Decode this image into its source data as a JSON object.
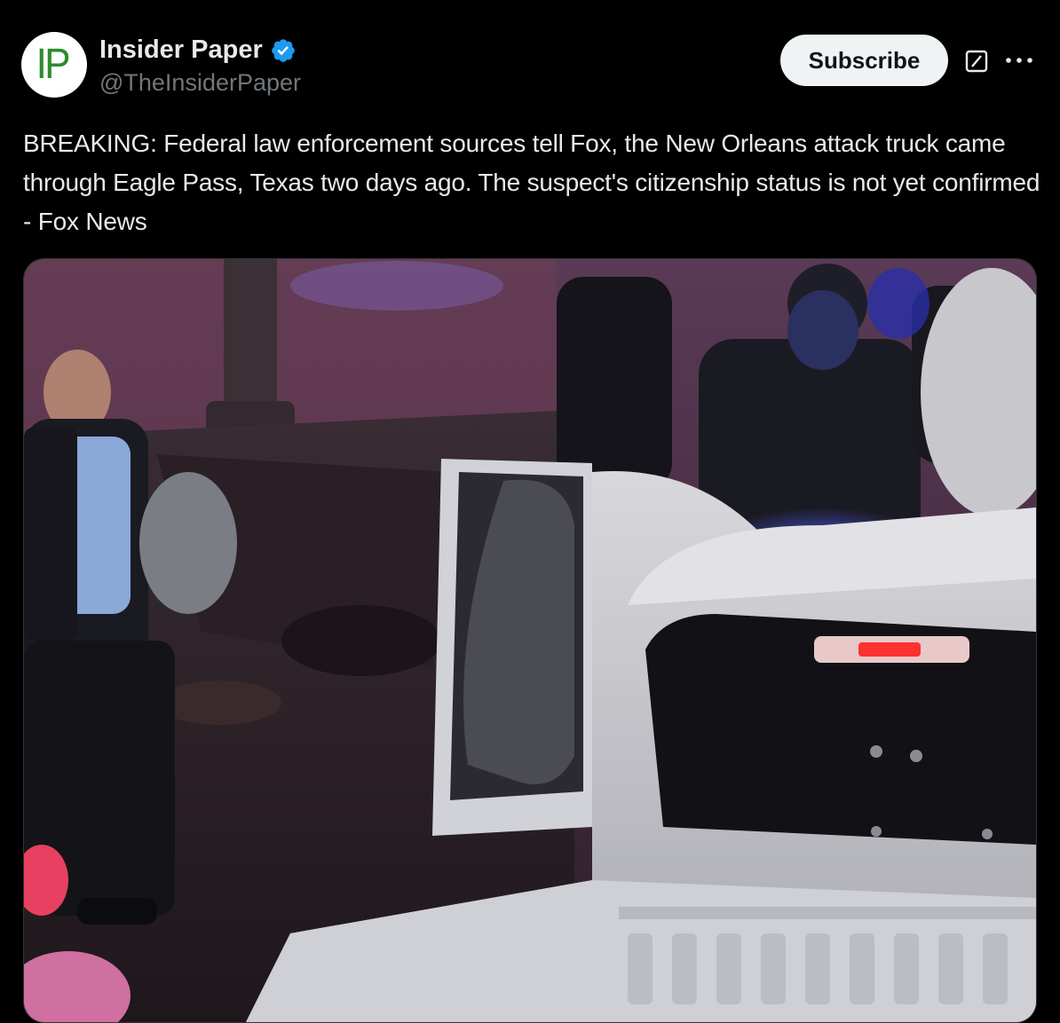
{
  "author": {
    "display_name": "Insider Paper",
    "handle": "@TheInsiderPaper",
    "avatar_text": "IP",
    "verified_icon": "verified-badge-icon",
    "verified_color": "#1d9bf0"
  },
  "actions": {
    "subscribe_label": "Subscribe",
    "grok_icon": "grok-icon",
    "more_icon": "more-options-icon"
  },
  "post": {
    "text": "BREAKING: Federal law enforcement sources tell Fox, the New Orleans attack truck came through Eagle Pass, Texas two days ago. The suspect's citizenship status is not yet confirmed - Fox News"
  },
  "colors": {
    "background": "#000000",
    "text_primary": "#e7e9ea",
    "text_secondary": "#71767b",
    "button_bg": "#eff3f4"
  }
}
